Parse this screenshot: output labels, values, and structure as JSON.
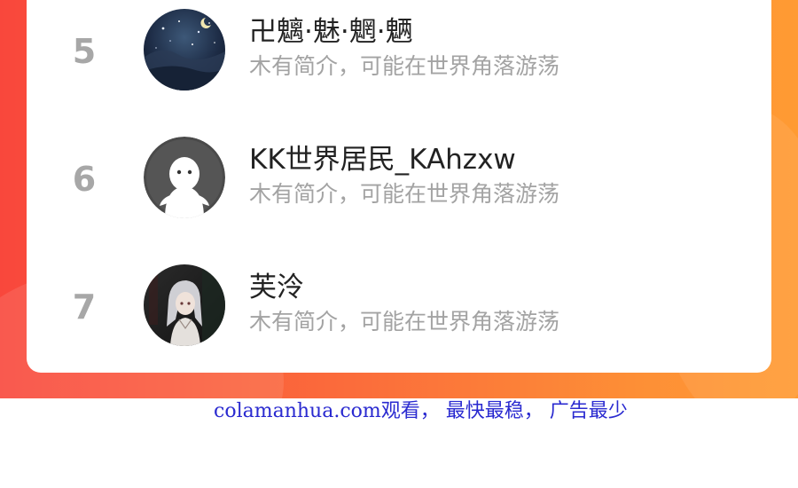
{
  "ranking": {
    "items": [
      {
        "rank": "5",
        "name": "卍魑·魅·魍·魉",
        "bio": "木有简介，可能在世界角落游荡",
        "avatar_icon": "night-sky-avatar"
      },
      {
        "rank": "6",
        "name": "KK世界居民_KAhzxw",
        "bio": "木有简介，可能在世界角落游荡",
        "avatar_icon": "default-ghost-avatar"
      },
      {
        "rank": "7",
        "name": "芙泠",
        "bio": "木有简介，可能在世界角落游荡",
        "avatar_icon": "anime-character-avatar"
      }
    ]
  },
  "watermark": {
    "text": "colamanhua.com观看， 最快最稳， 广告最少"
  },
  "colors": {
    "banner_start": "#f9473c",
    "banner_end": "#ff9b33",
    "rank_number": "#a7a7a7",
    "name": "#222222",
    "bio": "#a3a3a3",
    "watermark": "#2a2ad0"
  }
}
